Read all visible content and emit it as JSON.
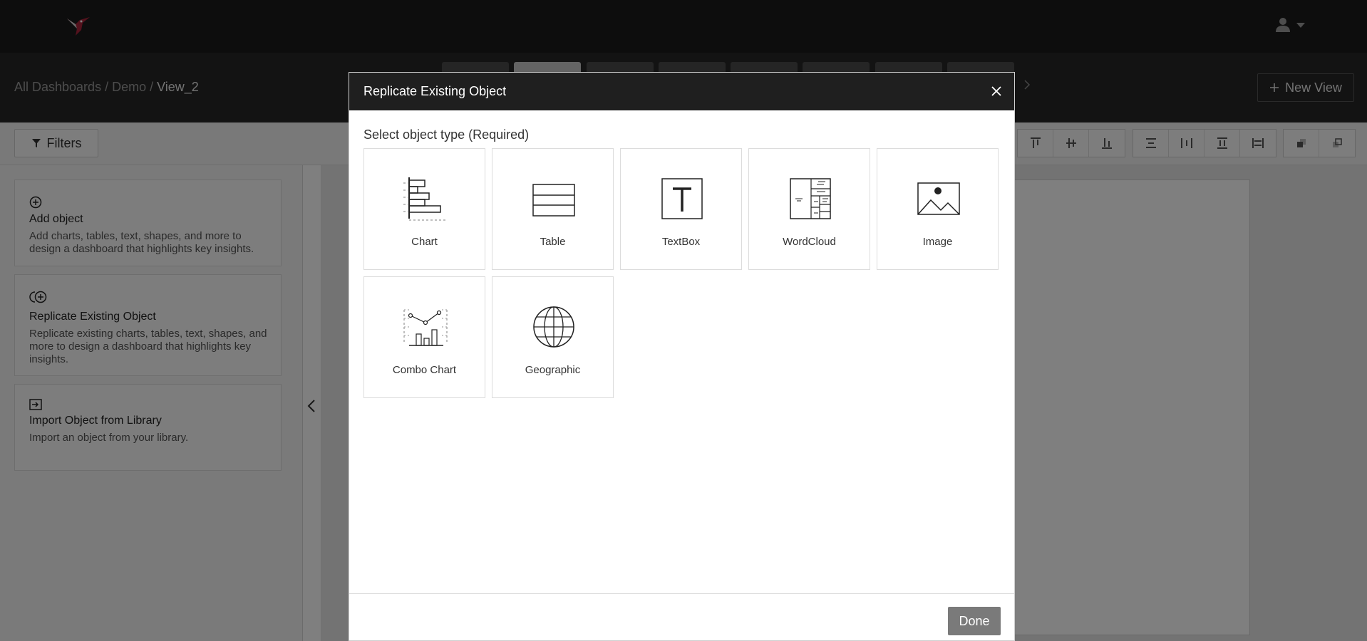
{
  "app": {
    "logo_icon": "hummingbird-logo-icon",
    "user_icon": "user-icon",
    "accent_color": "#a8243a"
  },
  "breadcrumb": {
    "root": "All Dashboards",
    "separator": "/",
    "dashboard": "Demo",
    "view": "View_2"
  },
  "header": {
    "new_view_label": "New View"
  },
  "toolbar": {
    "filters_label": "Filters"
  },
  "left_panel": {
    "items": [
      {
        "icon": "plus-circle-icon",
        "title": "Add object",
        "description": "Add charts, tables, text, shapes, and more to design a dashboard that highlights key insights."
      },
      {
        "icon": "replicate-icon",
        "title": "Replicate Existing Object",
        "description": "Replicate existing charts, tables, text, shapes, and more to design a dashboard that highlights key insights."
      },
      {
        "icon": "import-icon",
        "title": "Import Object from Library",
        "description": "Import an object from your library."
      }
    ]
  },
  "modal": {
    "title": "Replicate Existing Object",
    "section_label": "Select object type (Required)",
    "object_types": [
      {
        "label": "Chart",
        "icon": "bar-chart-icon"
      },
      {
        "label": "Table",
        "icon": "table-icon"
      },
      {
        "label": "TextBox",
        "icon": "textbox-icon"
      },
      {
        "label": "WordCloud",
        "icon": "wordcloud-icon"
      },
      {
        "label": "Image",
        "icon": "image-icon"
      },
      {
        "label": "Combo Chart",
        "icon": "combo-chart-icon"
      },
      {
        "label": "Geographic",
        "icon": "globe-icon"
      }
    ],
    "done_label": "Done"
  }
}
